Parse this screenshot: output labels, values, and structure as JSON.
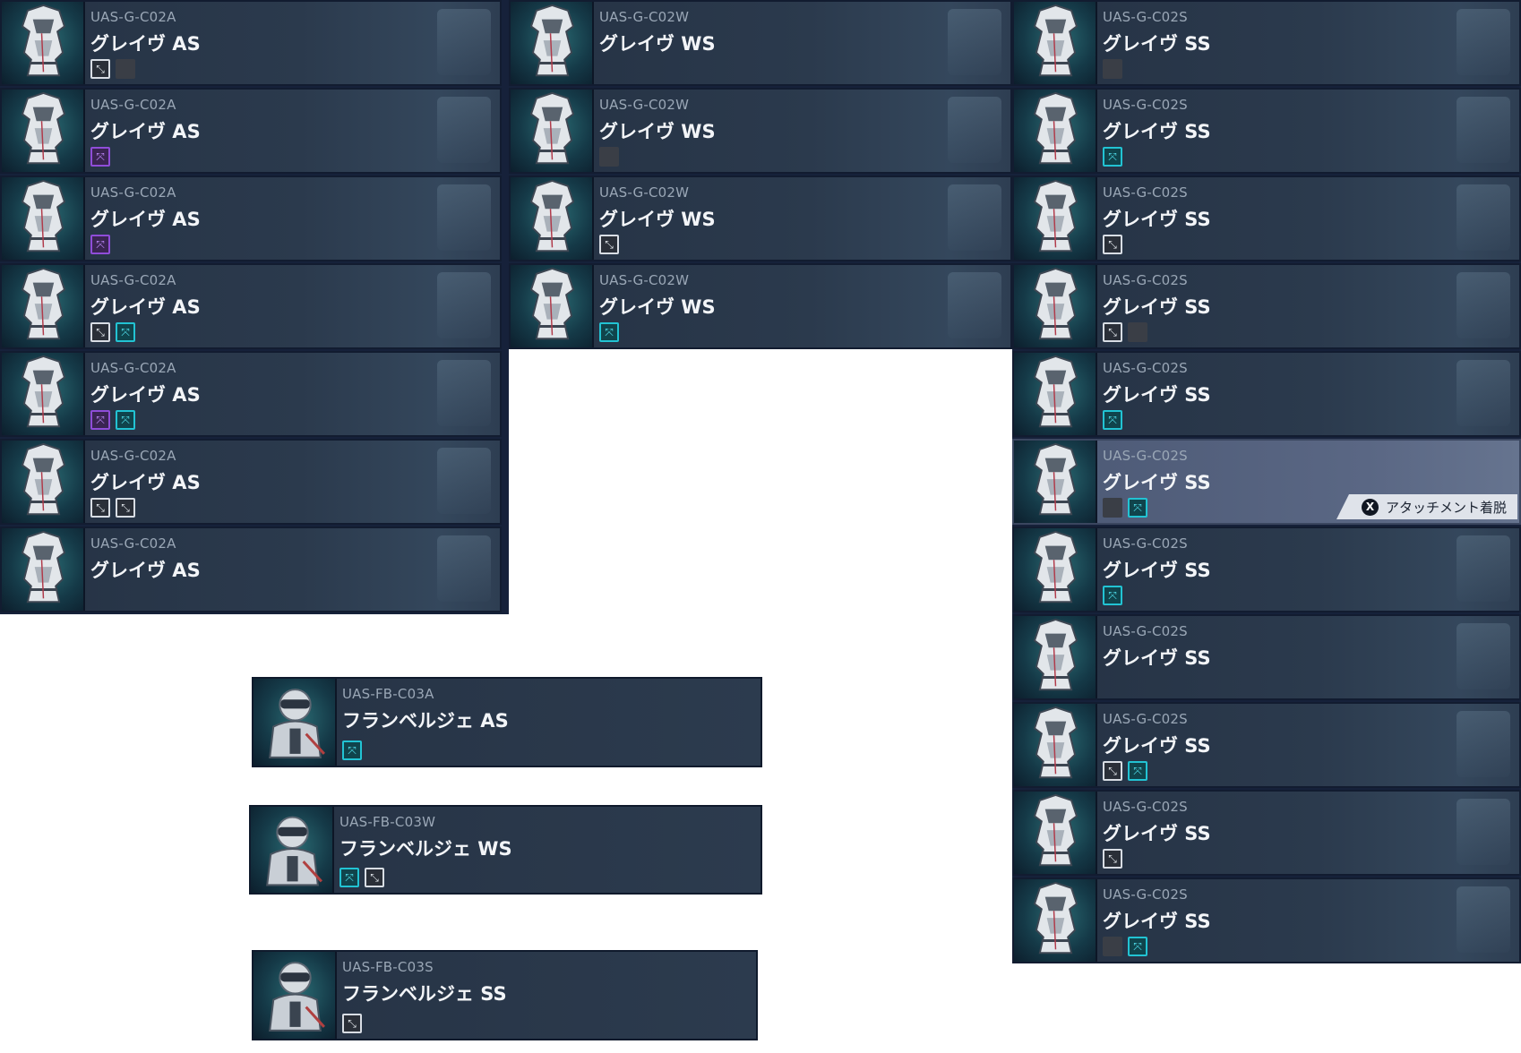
{
  "columns": [
    {
      "id": "as",
      "cards": [
        {
          "code": "UAS-G-C02A",
          "name": "グレイヴ AS",
          "attachments": [
            "white",
            "empty"
          ]
        },
        {
          "code": "UAS-G-C02A",
          "name": "グレイヴ AS",
          "attachments": [
            "purple"
          ]
        },
        {
          "code": "UAS-G-C02A",
          "name": "グレイヴ AS",
          "attachments": [
            "purple"
          ]
        },
        {
          "code": "UAS-G-C02A",
          "name": "グレイヴ AS",
          "attachments": [
            "white",
            "cyan"
          ]
        },
        {
          "code": "UAS-G-C02A",
          "name": "グレイヴ AS",
          "attachments": [
            "purple",
            "cyan"
          ]
        },
        {
          "code": "UAS-G-C02A",
          "name": "グレイヴ AS",
          "attachments": [
            "white",
            "white"
          ]
        },
        {
          "code": "UAS-G-C02A",
          "name": "グレイヴ AS",
          "attachments": []
        }
      ]
    },
    {
      "id": "ws",
      "cards": [
        {
          "code": "UAS-G-C02W",
          "name": "グレイヴ WS",
          "attachments": []
        },
        {
          "code": "UAS-G-C02W",
          "name": "グレイヴ WS",
          "attachments": [
            "empty"
          ]
        },
        {
          "code": "UAS-G-C02W",
          "name": "グレイヴ WS",
          "attachments": [
            "white"
          ]
        },
        {
          "code": "UAS-G-C02W",
          "name": "グレイヴ WS",
          "attachments": [
            "cyan"
          ]
        }
      ]
    },
    {
      "id": "ss",
      "cards": [
        {
          "code": "UAS-G-C02S",
          "name": "グレイヴ SS",
          "attachments": [
            "empty"
          ]
        },
        {
          "code": "UAS-G-C02S",
          "name": "グレイヴ SS",
          "attachments": [
            "cyan"
          ]
        },
        {
          "code": "UAS-G-C02S",
          "name": "グレイヴ SS",
          "attachments": [
            "white"
          ]
        },
        {
          "code": "UAS-G-C02S",
          "name": "グレイヴ SS",
          "attachments": [
            "white",
            "empty"
          ]
        },
        {
          "code": "UAS-G-C02S",
          "name": "グレイヴ SS",
          "attachments": [
            "cyan"
          ]
        },
        {
          "code": "UAS-G-C02S",
          "name": "グレイヴ SS",
          "attachments": [
            "empty",
            "cyan"
          ],
          "selected": true
        },
        {
          "code": "UAS-G-C02S",
          "name": "グレイヴ SS",
          "attachments": [
            "cyan"
          ]
        },
        {
          "code": "UAS-G-C02S",
          "name": "グレイヴ SS",
          "attachments": []
        },
        {
          "code": "UAS-G-C02S",
          "name": "グレイヴ SS",
          "attachments": [
            "white",
            "cyan"
          ]
        },
        {
          "code": "UAS-G-C02S",
          "name": "グレイヴ SS",
          "attachments": [
            "white"
          ]
        },
        {
          "code": "UAS-G-C02S",
          "name": "グレイヴ SS",
          "attachments": [
            "empty",
            "cyan"
          ]
        }
      ]
    }
  ],
  "solo_cards": [
    {
      "code": "UAS-FB-C03A",
      "name": "フランベルジェ AS",
      "attachments": [
        "cyan"
      ]
    },
    {
      "code": "UAS-FB-C03W",
      "name": "フランベルジェ WS",
      "attachments": [
        "cyan",
        "white"
      ]
    },
    {
      "code": "UAS-FB-C03S",
      "name": "フランベルジェ SS",
      "attachments": [
        "white"
      ]
    }
  ],
  "hint": {
    "button": "X",
    "label": "アタッチメント着脱"
  },
  "colors": {
    "accent_cyan": "#22c3d3",
    "accent_purple": "#8f4dd8",
    "card_bg": "#2b3a4d"
  }
}
